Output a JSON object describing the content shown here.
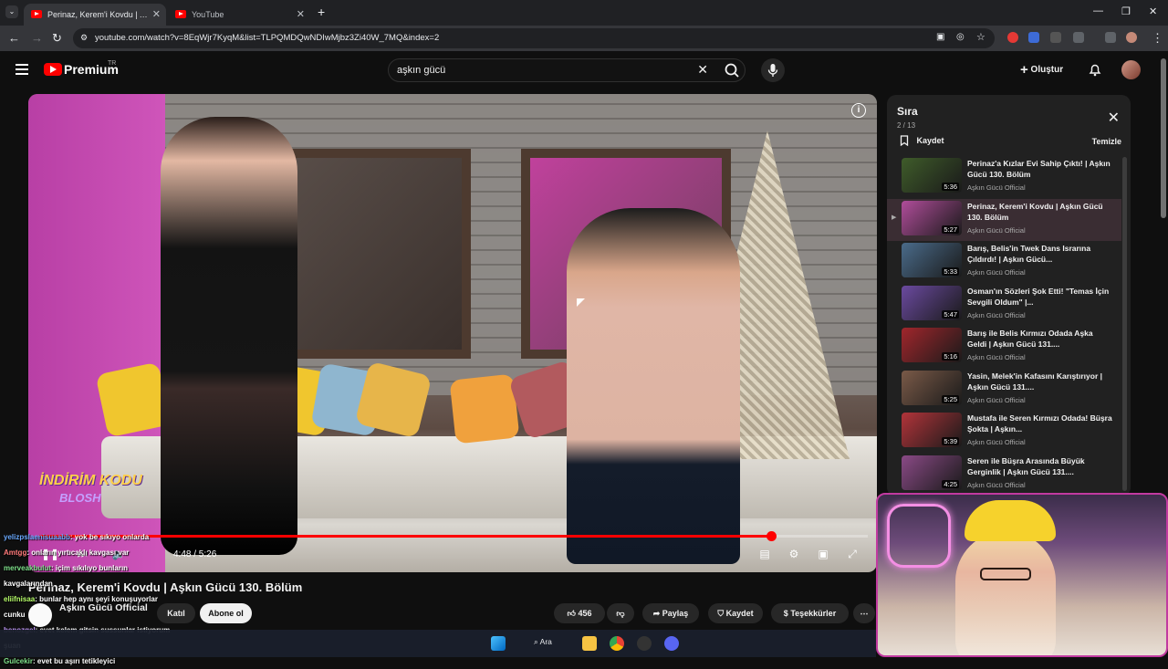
{
  "browser": {
    "tabs": [
      {
        "title": "Perinaz, Kerem'i Kovdu | Aşkın Gücü 130. Bölüm",
        "active": true
      },
      {
        "title": "YouTube",
        "active": false
      }
    ],
    "new_tab_icon": "+",
    "url": "youtube.com/watch?v=8EqWjr7KyqM&list=TLPQMDQwNDIwMjbz3Zi40W_7MQ&index=2",
    "window_controls": {
      "minimize": "—",
      "maximize": "❐",
      "close": "✕"
    }
  },
  "yt_header": {
    "logo_text": "Premium",
    "logo_region": "TR",
    "search_value": "aşkın gücü",
    "create_label": "Oluştur"
  },
  "player": {
    "time": "4:48 / 5:26",
    "progress_fraction": 0.883,
    "overlay_line1": "İNDİRİM KODU",
    "overlay_line2": "BLOSH"
  },
  "queue": {
    "title": "Sıra",
    "position": "2 / 13",
    "save_label": "Kaydet",
    "clear_label": "Temizle",
    "items": [
      {
        "title": "Perinaz'a Kızlar Evi Sahip Çıktı! | Aşkın Gücü 130. Bölüm",
        "channel": "Aşkın Gücü Official",
        "duration": "5:36",
        "active": false,
        "color": "#3f5c2a"
      },
      {
        "title": "Perinaz, Kerem'i Kovdu | Aşkın Gücü 130. Bölüm",
        "channel": "Aşkın Gücü Official",
        "duration": "5:27",
        "active": true,
        "color": "#b04d9a"
      },
      {
        "title": "Barış, Belis'in Twek Dans Israrına Çıldırdı! | Aşkın Gücü...",
        "channel": "Aşkın Gücü Official",
        "duration": "5:33",
        "active": false,
        "color": "#4a6b8a"
      },
      {
        "title": "Osman'ın Sözleri Şok Etti! \"Temas İçin Sevgili Oldum\" |...",
        "channel": "Aşkın Gücü Official",
        "duration": "5:47",
        "active": false,
        "color": "#6b4aa0"
      },
      {
        "title": "Barış ile Belis Kırmızı Odada Aşka Geldi | Aşkın Gücü 131....",
        "channel": "Aşkın Gücü Official",
        "duration": "5:16",
        "active": false,
        "color": "#a1262c"
      },
      {
        "title": "Yasin, Melek'in Kafasını Karıştırıyor | Aşkın Gücü 131....",
        "channel": "Aşkın Gücü Official",
        "duration": "5:25",
        "active": false,
        "color": "#7a5a48"
      },
      {
        "title": "Mustafa ile Seren Kırmızı Odada! Büşra Şokta | Aşkın...",
        "channel": "Aşkın Gücü Official",
        "duration": "5:39",
        "active": false,
        "color": "#b2343a"
      },
      {
        "title": "Seren ile Büşra Arasında Büyük Gerginlik | Aşkın Gücü 131....",
        "channel": "Aşkın Gücü Official",
        "duration": "4:25",
        "active": false,
        "color": "#8a4a86"
      }
    ]
  },
  "below_video": {
    "title": "Perinaz, Kerem'i Kovdu | Aşkın Gücü 130. Bölüm",
    "channel": "Aşkın Gücü Official",
    "join_label": "Katıl",
    "subscribe_label": "Abone ol",
    "likes": "456",
    "share_label": "Paylaş",
    "save_label": "Kaydet",
    "thanks_label": "Teşekkürler"
  },
  "chat": [
    {
      "user": "yelizpslaenisuaabb",
      "msg": ": yok be sıkıyo onlarda",
      "color": "#6aa9ff"
    },
    {
      "user": "Amtgg",
      "msg": ": onların yırtıcaklı kavgası var",
      "color": "#ff7a7a"
    },
    {
      "user": "merveakbulut",
      "msg": ": içim sıkılıyo bunların",
      "color": "#7ee08a"
    },
    {
      "user": "",
      "msg": "kavgalarından",
      "color": "#ffffff"
    },
    {
      "user": "eliifnisaa",
      "msg": ": bunlar hep aynı şeyi konuşuyorlar",
      "color": "#b8ff6a"
    },
    {
      "user": "",
      "msg": "cunku",
      "color": "#ffffff"
    },
    {
      "user": "benozgel",
      "msg": ": evet kelem gitsin sussunlar istiyorum",
      "color": "#c59bff"
    },
    {
      "user": "",
      "msg": "şuan",
      "color": "#ffffff"
    },
    {
      "user": "Gulcekir",
      "msg": ": evet bu aşırı tetikleyici",
      "color": "#7ee08a"
    }
  ],
  "taskbar": {
    "search_label": "Ara"
  }
}
